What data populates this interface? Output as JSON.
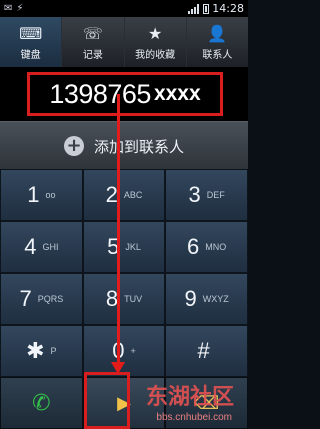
{
  "statusbar": {
    "time": "14:28"
  },
  "tabs": [
    {
      "label": "键盘",
      "icon": "keypad-icon",
      "glyph": "⌨"
    },
    {
      "label": "记录",
      "icon": "call-log-icon",
      "glyph": "☏"
    },
    {
      "label": "我的收藏",
      "icon": "star-icon",
      "glyph": "★"
    },
    {
      "label": "联系人",
      "icon": "contacts-icon",
      "glyph": "👤"
    }
  ],
  "number_display": {
    "digits": "1398765",
    "tail": "xxxx"
  },
  "add_contact": {
    "label": "添加到联系人"
  },
  "keypad": [
    {
      "digit": "1",
      "letters": "ᴏᴏ"
    },
    {
      "digit": "2",
      "letters": "ABC"
    },
    {
      "digit": "3",
      "letters": "DEF"
    },
    {
      "digit": "4",
      "letters": "GHI"
    },
    {
      "digit": "5",
      "letters": "JKL"
    },
    {
      "digit": "6",
      "letters": "MNO"
    },
    {
      "digit": "7",
      "letters": "PQRS"
    },
    {
      "digit": "8",
      "letters": "TUV"
    },
    {
      "digit": "9",
      "letters": "WXYZ"
    },
    {
      "digit": "✱",
      "letters": "P"
    },
    {
      "digit": "0",
      "letters": "+"
    },
    {
      "digit": "#",
      "letters": ""
    }
  ],
  "watermark": {
    "title": "东湖社区",
    "url": "bbs.cnhubei.com"
  },
  "colors": {
    "highlight": "#d81e1e",
    "call_green": "#34c34a"
  }
}
